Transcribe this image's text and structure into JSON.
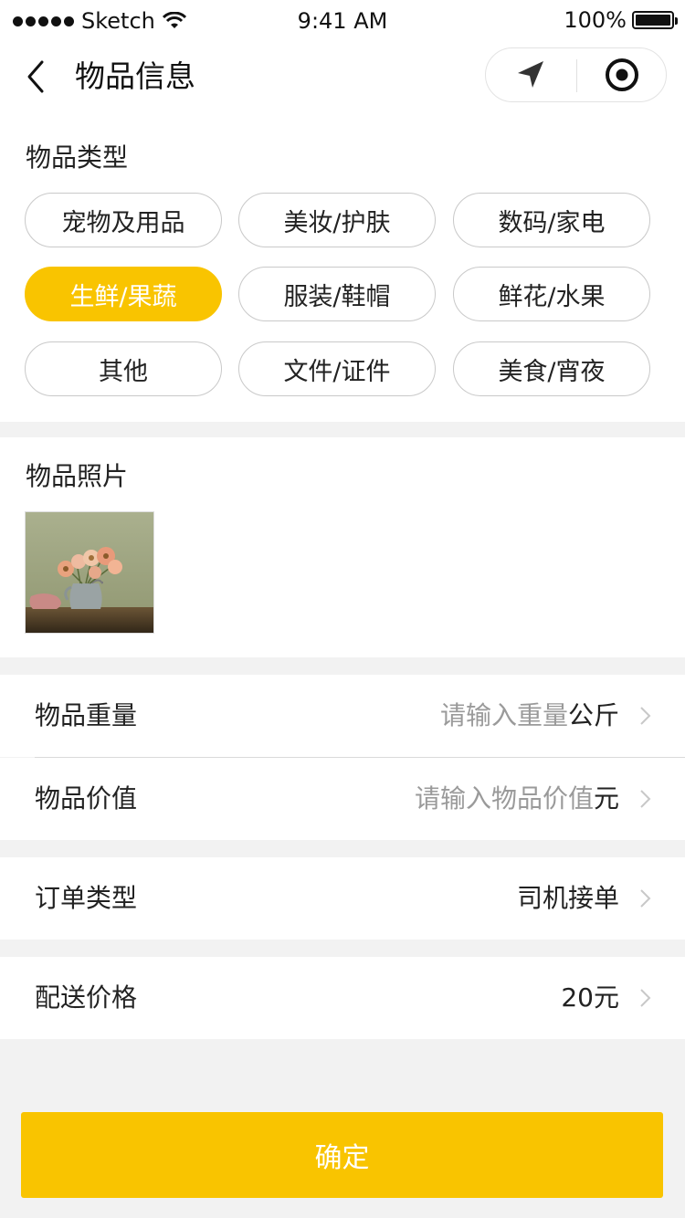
{
  "status_bar": {
    "carrier": "Sketch",
    "time": "9:41 AM",
    "battery": "100%",
    "battery_level": 1.0
  },
  "nav": {
    "title": "物品信息",
    "icons": [
      "back-chevron-icon",
      "location-arrow-icon",
      "record-circle-icon"
    ]
  },
  "category": {
    "title": "物品类型",
    "items": [
      "宠物及用品",
      "美妆/护肤",
      "数码/家电",
      "生鲜/果蔬",
      "服装/鞋帽",
      "鲜花/水果",
      "其他",
      "文件/证件",
      "美食/宵夜"
    ],
    "selected_index": 3
  },
  "photo": {
    "title": "物品照片"
  },
  "weight": {
    "label": "物品重量",
    "placeholder": "请输入重量",
    "unit": "公斤"
  },
  "value": {
    "label": "物品价值",
    "placeholder": "请输入物品价值",
    "unit": "元"
  },
  "order_type": {
    "label": "订单类型",
    "value": "司机接单"
  },
  "delivery_price": {
    "label": "配送价格",
    "value": "20元"
  },
  "confirm": {
    "label": "确定"
  },
  "colors": {
    "accent": "#f9c400",
    "background": "#f2f2f2",
    "placeholder": "#9a9a9a"
  }
}
